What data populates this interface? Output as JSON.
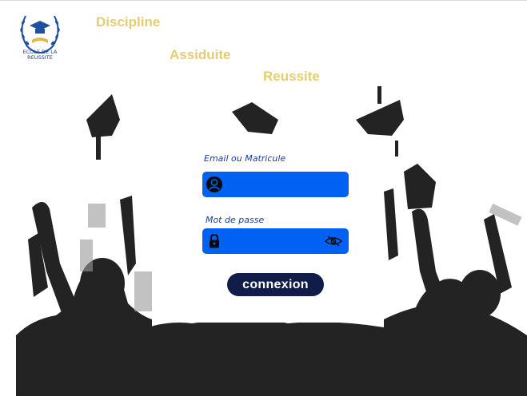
{
  "school": {
    "name_line1": "ECOLE DE LA",
    "name_line2": "REUSSITE"
  },
  "motto": [
    "Discipline",
    "Assiduite",
    "Reussite"
  ],
  "login": {
    "email_label": "Email ou Matricule",
    "email_value": "",
    "password_label": "Mot de passe",
    "password_value": "",
    "submit_label": "connexion"
  },
  "colors": {
    "motto": "#e6cd72",
    "field": "#0061f2",
    "button": "#111c48",
    "label": "#1f3f9a",
    "silhouette": "#222222"
  },
  "icons": {
    "email_field": "user-circle-icon",
    "password_field": "lock-icon",
    "password_toggle": "eye-slash-icon",
    "logo": "graduation-laurel-logo"
  }
}
